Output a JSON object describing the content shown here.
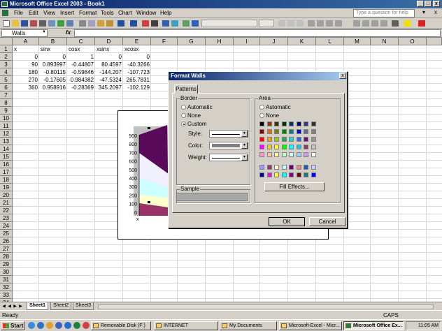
{
  "window": {
    "title": "Microsoft Office Excel 2003 - Book1"
  },
  "menu": [
    "File",
    "Edit",
    "View",
    "Insert",
    "Format",
    "Tools",
    "Chart",
    "Window",
    "Help"
  ],
  "help_placeholder": "Type a question for help",
  "formula_bar": {
    "name_box": "Walls",
    "fx": "fx"
  },
  "columns": [
    "A",
    "B",
    "C",
    "D",
    "E",
    "F",
    "G",
    "H",
    "I",
    "J",
    "K",
    "L",
    "M",
    "N",
    "O"
  ],
  "rows": [
    "1",
    "2",
    "3",
    "4",
    "5",
    "6",
    "7",
    "8",
    "9",
    "10",
    "11",
    "12",
    "13",
    "14",
    "15",
    "16",
    "17",
    "18",
    "19",
    "20",
    "21",
    "22",
    "23",
    "24",
    "25",
    "26",
    "27",
    "28",
    "29",
    "30",
    "31",
    "32",
    "33",
    "34"
  ],
  "cells": {
    "headers": [
      "x",
      "sinx",
      "cosx",
      "xsinx",
      "xcosx"
    ],
    "r2": [
      "0",
      "0",
      "1",
      "0",
      "0"
    ],
    "r3": [
      "90",
      "0.893997",
      "-0.44807",
      "80.4597",
      "-40.3266"
    ],
    "r4": [
      "180",
      "-0.80115",
      "-0.59846",
      "-144.207",
      "-107.723"
    ],
    "r5": [
      "270",
      "-0.17605",
      "0.984382",
      "-47.5324",
      "265.7831"
    ],
    "r6": [
      "360",
      "0.958916",
      "-0.28369",
      "345.2097",
      "-102.129"
    ]
  },
  "chart": {
    "y_ticks": [
      "900",
      "800",
      "700",
      "600",
      "500",
      "400",
      "300",
      "200",
      "100",
      "0"
    ],
    "x_label": "x"
  },
  "dialog": {
    "title": "Format Walls",
    "close": "x",
    "tab": "Patterns",
    "border": {
      "label": "Border",
      "automatic": "Automatic",
      "none": "None",
      "custom": "Custom",
      "style": "Style:",
      "color": "Color:",
      "weight": "Weight:"
    },
    "area": {
      "label": "Area",
      "automatic": "Automatic",
      "none": "None",
      "fill_effects": "Fill Effects..."
    },
    "sample": "Sample",
    "ok": "OK",
    "cancel": "Cancel",
    "palette": [
      [
        "#000000",
        "#993300",
        "#333300",
        "#003300",
        "#003366",
        "#000080",
        "#333399",
        "#333333"
      ],
      [
        "#800000",
        "#ff6600",
        "#808000",
        "#008000",
        "#008080",
        "#0000ff",
        "#666699",
        "#808080"
      ],
      [
        "#ff0000",
        "#ff9900",
        "#99cc00",
        "#339966",
        "#33cccc",
        "#3366ff",
        "#800080",
        "#969696"
      ],
      [
        "#ff00ff",
        "#ffcc00",
        "#ffff00",
        "#00ff00",
        "#00ffff",
        "#00ccff",
        "#993366",
        "#c0c0c0"
      ],
      [
        "#ff99cc",
        "#ffcc99",
        "#ffff99",
        "#ccffcc",
        "#ccffff",
        "#99ccff",
        "#cc99ff",
        "#ffffff"
      ],
      [
        "#9999ff",
        "#993366",
        "#ffffcc",
        "#ccffff",
        "#660066",
        "#ff8080",
        "#0066cc",
        "#ccccff"
      ],
      [
        "#000080",
        "#ff00ff",
        "#ffff00",
        "#00ffff",
        "#800080",
        "#800000",
        "#008080",
        "#0000ff"
      ]
    ]
  },
  "sheet_tabs": [
    "Sheet1",
    "Sheet2",
    "Sheet3"
  ],
  "status": {
    "ready": "Ready",
    "caps": "CAPS"
  },
  "taskbar": {
    "start": "Start",
    "tasks": [
      "Removable Disk (F:)",
      "INTERNET",
      "My Documents",
      "Microsoft-Excel - Micr...",
      "Microsoft Office Ex..."
    ],
    "clock": "11:05 AM"
  }
}
